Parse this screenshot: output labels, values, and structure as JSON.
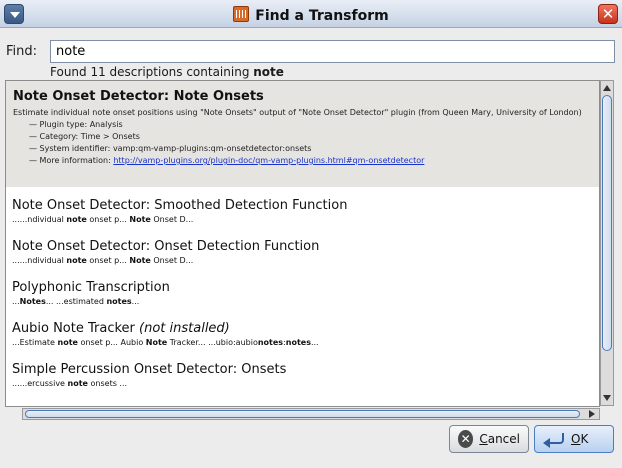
{
  "window": {
    "title": "Find a Transform",
    "close_glyph": "✕"
  },
  "search": {
    "label": "Find:",
    "value": "note"
  },
  "status": {
    "prefix": "Found 11 descriptions containing ",
    "term": "note"
  },
  "selected": {
    "name": "Note Onset Detector: Note Onsets",
    "description": "Estimate individual note onset positions using \"Note Onsets\" output of \"Note Onset Detector\" plugin (from Queen Mary, University of London)",
    "details": [
      {
        "label": "Plugin type:",
        "value": "Analysis"
      },
      {
        "label": "Category:",
        "value": "Time > Onsets"
      },
      {
        "label": "System identifier:",
        "value": "vamp:qm-vamp-plugins:qm-onsetdetector:onsets"
      }
    ],
    "more_info_label": "More information:",
    "more_info_link": "http://vamp-plugins.org/plugin-doc/qm-vamp-plugins.html#qm-onsetdetector"
  },
  "results": [
    {
      "name": "Note Onset Detector: Smoothed Detection Function",
      "suffix": "",
      "match": [
        [
          "......ndividual ",
          false
        ],
        [
          "note",
          true
        ],
        [
          " onset p... ",
          false
        ],
        [
          "Note",
          true
        ],
        [
          " Onset D...",
          false
        ]
      ]
    },
    {
      "name": "Note Onset Detector: Onset Detection Function",
      "suffix": "",
      "match": [
        [
          "......ndividual ",
          false
        ],
        [
          "note",
          true
        ],
        [
          " onset p... ",
          false
        ],
        [
          "Note",
          true
        ],
        [
          " Onset D...",
          false
        ]
      ]
    },
    {
      "name": "Polyphonic Transcription",
      "suffix": "",
      "match": [
        [
          "...",
          false
        ],
        [
          "Notes",
          true
        ],
        [
          "... ...estimated ",
          false
        ],
        [
          "notes",
          true
        ],
        [
          "...",
          false
        ]
      ]
    },
    {
      "name": "Aubio Note Tracker ",
      "suffix": "(not installed)",
      "match": [
        [
          "...Estimate ",
          false
        ],
        [
          "note",
          true
        ],
        [
          " onset p... Aubio ",
          false
        ],
        [
          "Note",
          true
        ],
        [
          " Tracker... ...ubio:aubio",
          false
        ],
        [
          "notes",
          true
        ],
        [
          ":",
          false
        ],
        [
          "notes",
          true
        ],
        [
          "...",
          false
        ]
      ]
    },
    {
      "name": "Simple Percussion Onset Detector: Onsets",
      "suffix": "",
      "match": [
        [
          "......ercussive ",
          false
        ],
        [
          "note",
          true
        ],
        [
          " onsets ...",
          false
        ]
      ]
    }
  ],
  "buttons": {
    "cancel": {
      "mnemonic": "C",
      "rest": "ancel"
    },
    "ok": {
      "mnemonic": "O",
      "rest": "K"
    }
  },
  "icons": {
    "menu": "window-menu-icon",
    "app": "waveform-app-icon",
    "close": "close-icon",
    "cancel": "cancel-icon",
    "ok": "ok-arrow-icon"
  }
}
